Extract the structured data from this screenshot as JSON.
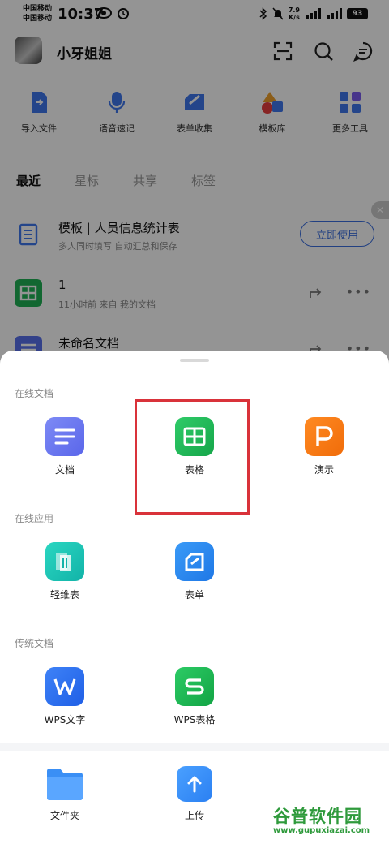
{
  "status_bar": {
    "carrier_1": "中国移动",
    "carrier_2": "中国移动",
    "time": "10:37",
    "speed_value": "7.9",
    "speed_unit": "K/s",
    "battery": "93"
  },
  "header": {
    "username": "小牙姐姐"
  },
  "quick_actions": [
    {
      "label": "导入文件",
      "icon": "import-file-icon"
    },
    {
      "label": "语音速记",
      "icon": "microphone-icon"
    },
    {
      "label": "表单收集",
      "icon": "form-collect-icon"
    },
    {
      "label": "模板库",
      "icon": "template-shapes-icon"
    },
    {
      "label": "更多工具",
      "icon": "grid-tools-icon"
    }
  ],
  "tabs": [
    {
      "label": "最近",
      "active": true
    },
    {
      "label": "星标",
      "active": false
    },
    {
      "label": "共享",
      "active": false
    },
    {
      "label": "标签",
      "active": false
    }
  ],
  "files": [
    {
      "title": "模板 | 人员信息统计表",
      "subtitle": "多人同时填写 自动汇总和保存",
      "action": "立即使用"
    },
    {
      "title": "1",
      "subtitle": "11小时前  来自 我的文档"
    },
    {
      "title": "未命名文档",
      "subtitle": ""
    }
  ],
  "sheet": {
    "sections": [
      {
        "title": "在线文档",
        "items": [
          {
            "label": "文档",
            "color": "#6f7cf2"
          },
          {
            "label": "表格",
            "color": "#20b255"
          },
          {
            "label": "演示",
            "color": "#f5780f"
          }
        ]
      },
      {
        "title": "在线应用",
        "items": [
          {
            "label": "轻维表",
            "color": "#18c4b3"
          },
          {
            "label": "表单",
            "color": "#2d8cf0"
          }
        ]
      },
      {
        "title": "传统文档",
        "items": [
          {
            "label": "WPS文字",
            "color": "#2a6ff2"
          },
          {
            "label": "WPS表格",
            "color": "#21ab4f"
          }
        ]
      }
    ],
    "bottom_items": [
      {
        "label": "文件夹",
        "color": "#3a8ff5"
      },
      {
        "label": "上传",
        "color": "#3a8ff5"
      }
    ]
  },
  "watermark": {
    "title": "谷普软件园",
    "url": "www.gupuxiazai.com"
  }
}
